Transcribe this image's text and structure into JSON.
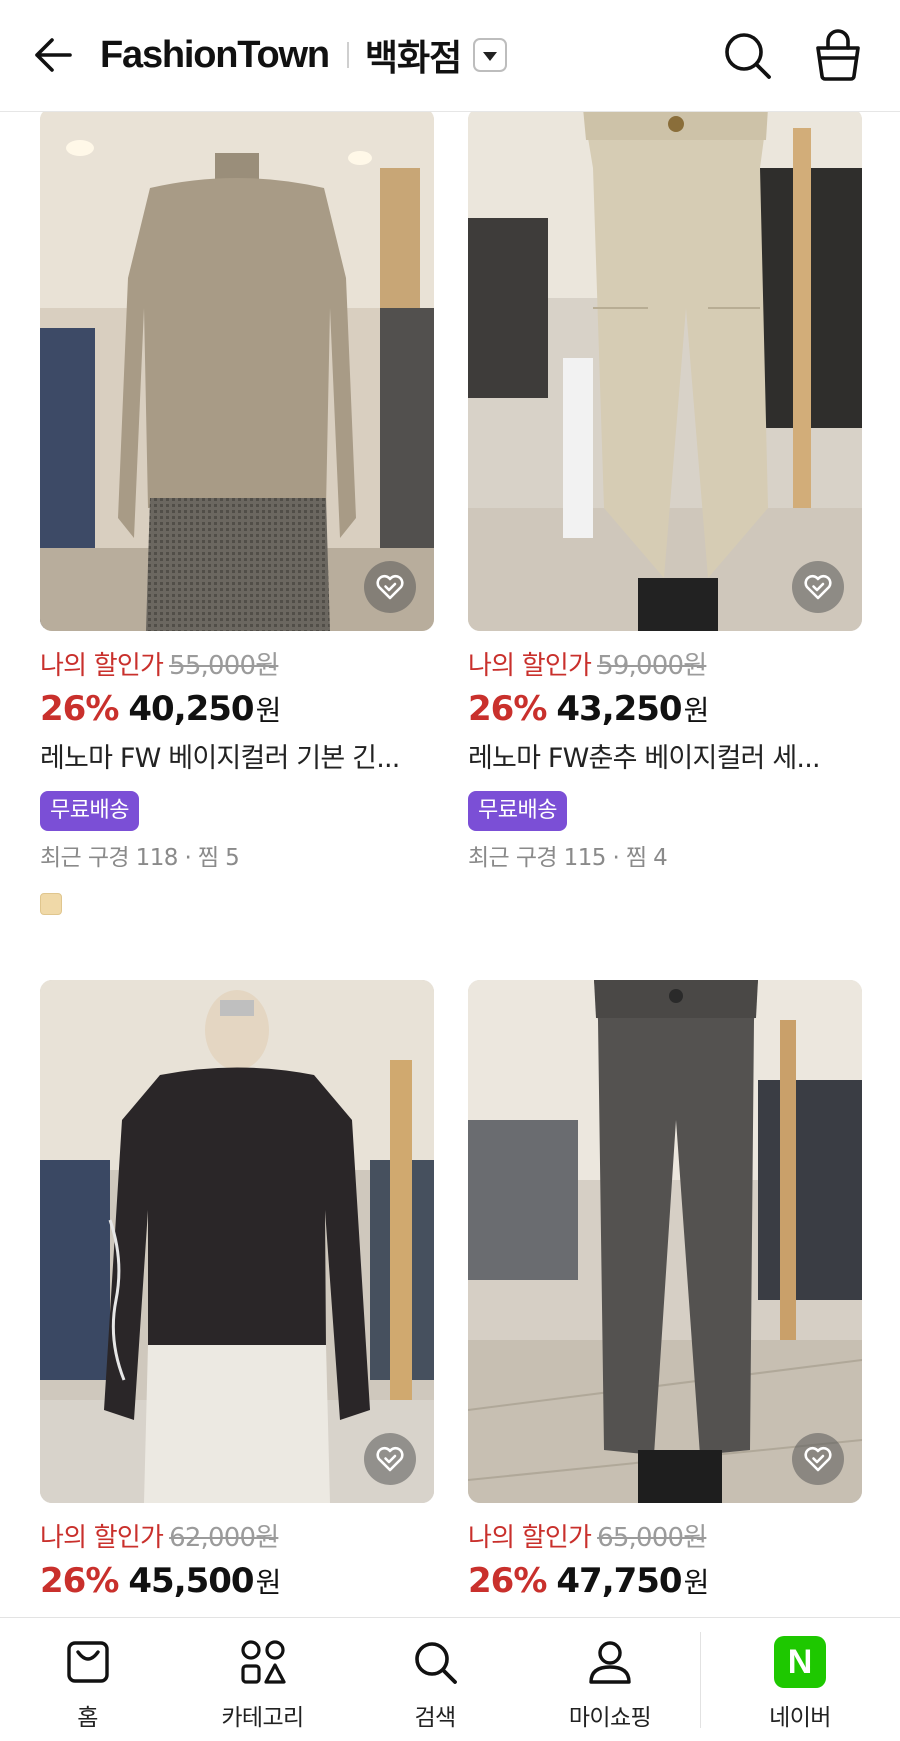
{
  "header": {
    "brand": "FashionTown",
    "store": "백화점"
  },
  "products": [
    {
      "my_price_label": "나의 할인가",
      "original_price": "55,000원",
      "discount": "26%",
      "price": "40,250",
      "currency": "원",
      "title": "레노마 FW 베이지컬러 기본 긴...",
      "badge": "무료배송",
      "meta": "최근 구경 118 · 찜 5",
      "swatch_color": "#f0d9a8"
    },
    {
      "my_price_label": "나의 할인가",
      "original_price": "59,000원",
      "discount": "26%",
      "price": "43,250",
      "currency": "원",
      "title": "레노마 FW춘추 베이지컬러 세...",
      "badge": "무료배송",
      "meta": "최근 구경 115 · 찜 4"
    },
    {
      "my_price_label": "나의 할인가",
      "original_price": "62,000원",
      "discount": "26%",
      "price": "45,500",
      "currency": "원"
    },
    {
      "my_price_label": "나의 할인가",
      "original_price": "65,000원",
      "discount": "26%",
      "price": "47,750",
      "currency": "원"
    }
  ],
  "bottom_nav": [
    {
      "label": "홈",
      "icon": "home-bag-icon"
    },
    {
      "label": "카테고리",
      "icon": "category-icon"
    },
    {
      "label": "검색",
      "icon": "search-icon"
    },
    {
      "label": "마이쇼핑",
      "icon": "person-icon"
    },
    {
      "label": "네이버",
      "icon": "naver-logo-icon"
    }
  ],
  "colors": {
    "discount_red": "#c9302c",
    "badge_purple": "#7b4fd6",
    "naver_green": "#1ec800"
  }
}
